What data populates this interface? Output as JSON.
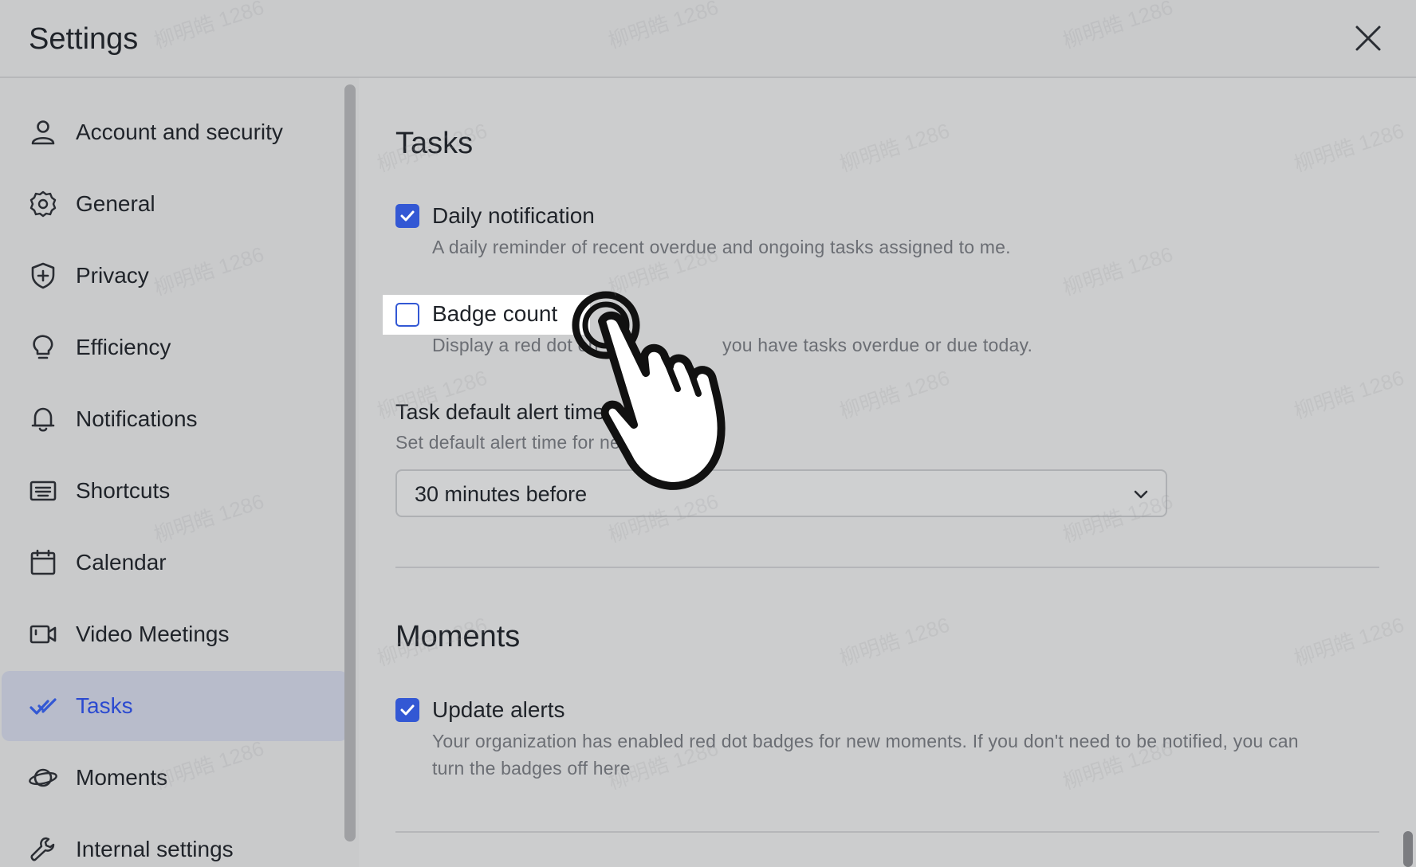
{
  "header": {
    "title": "Settings",
    "close_icon": "close-icon"
  },
  "sidebar": {
    "items": [
      {
        "label": "Account and security",
        "icon": "user-icon",
        "active": false
      },
      {
        "label": "General",
        "icon": "gear-icon",
        "active": false
      },
      {
        "label": "Privacy",
        "icon": "shield-icon",
        "active": false
      },
      {
        "label": "Efficiency",
        "icon": "lightbulb-icon",
        "active": false
      },
      {
        "label": "Notifications",
        "icon": "bell-icon",
        "active": false
      },
      {
        "label": "Shortcuts",
        "icon": "keyboard-icon",
        "active": false
      },
      {
        "label": "Calendar",
        "icon": "calendar-icon",
        "active": false
      },
      {
        "label": "Video Meetings",
        "icon": "video-camera-icon",
        "active": false
      },
      {
        "label": "Tasks",
        "icon": "tasks-check-icon",
        "active": true
      },
      {
        "label": "Moments",
        "icon": "planet-icon",
        "active": false
      },
      {
        "label": "Internal settings",
        "icon": "wrench-icon",
        "active": false
      }
    ]
  },
  "main": {
    "tasks": {
      "title": "Tasks",
      "daily_notification": {
        "label": "Daily notification",
        "description": "A daily reminder of recent overdue and ongoing tasks assigned to me.",
        "checked": true
      },
      "badge_count": {
        "label": "Badge count",
        "description": "Display a red dot on",
        "description_tail": "you have tasks overdue or due today.",
        "checked": false
      },
      "alert_time": {
        "title": "Task default alert time",
        "description": "Set default alert time for new tasks",
        "selected": "30 minutes before"
      }
    },
    "moments": {
      "title": "Moments",
      "update_alerts": {
        "label": "Update alerts",
        "description_line1": "Your organization has enabled red dot badges for new moments. If you don't need to be notified, you can",
        "description_line2": "turn the badges off here",
        "checked": true
      }
    }
  },
  "watermark_text": "柳明皓 1286",
  "colors": {
    "accent": "#3358d4",
    "active_bg": "#b8bccb"
  }
}
